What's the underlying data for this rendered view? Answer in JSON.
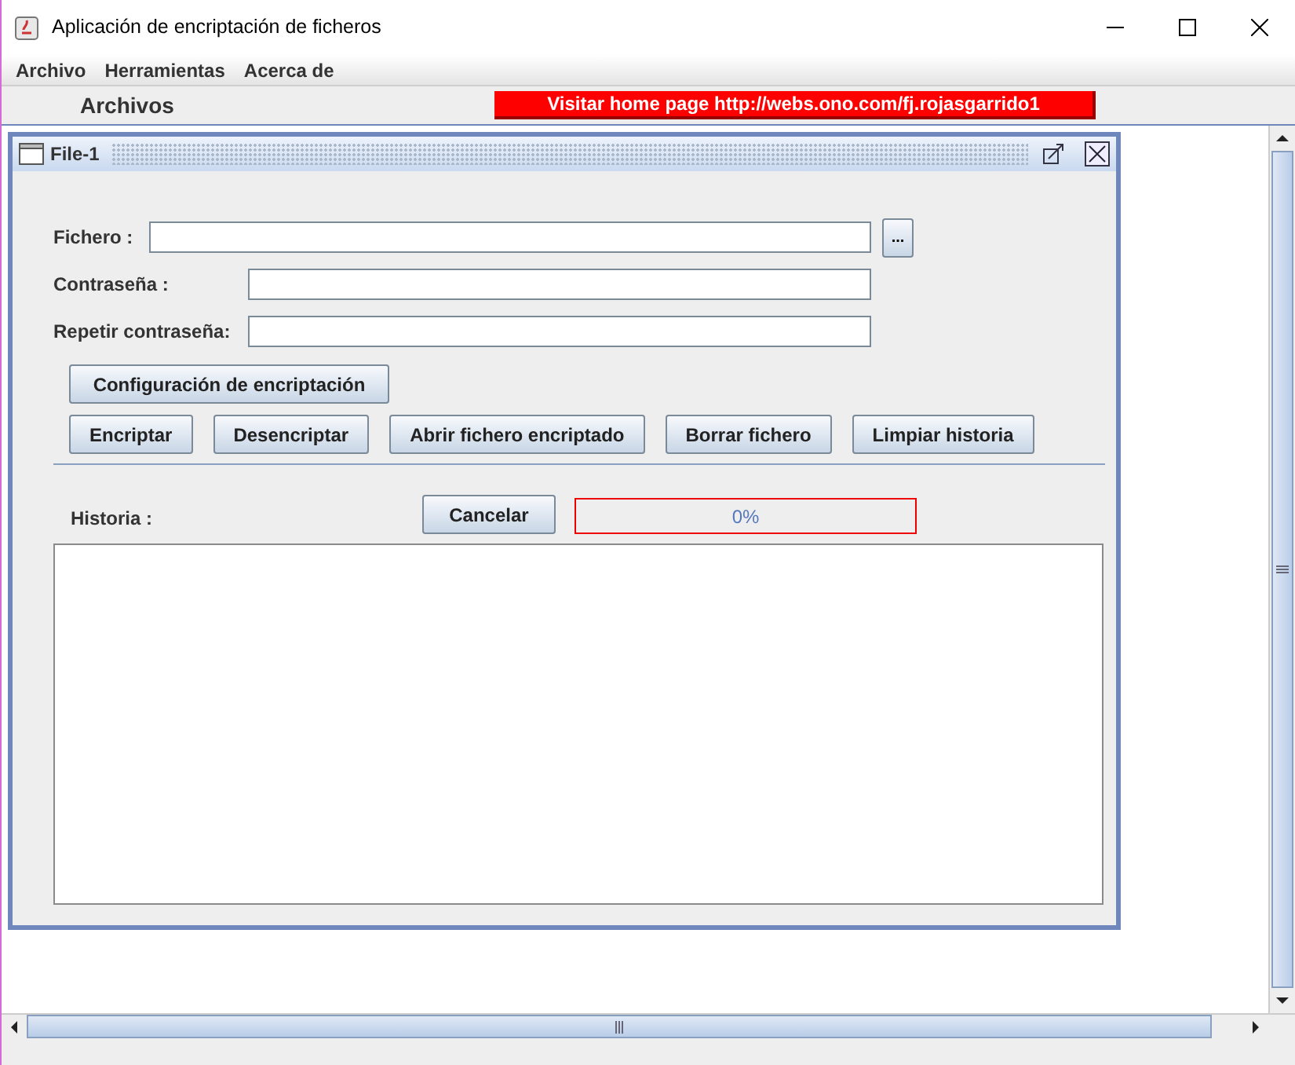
{
  "window": {
    "title": "Aplicación de encriptación de ficheros"
  },
  "menu": [
    "Archivo",
    "Herramientas",
    "Acerca de"
  ],
  "toolbar": {
    "heading": "Archivos",
    "link": "Visitar home page http://webs.ono.com/fj.rojasgarrido1"
  },
  "internal_frame": {
    "title": "File-1",
    "fields": [
      {
        "label": "Fichero :",
        "browse": "..."
      },
      {
        "label": "Contraseña :"
      },
      {
        "label": "Repetir contraseña:"
      }
    ],
    "config_button": "Configuración de encriptación",
    "actions": [
      "Encriptar",
      "Desencriptar",
      "Abrir fichero encriptado",
      "Borrar fichero",
      "Limpiar historia"
    ],
    "history_label": "Historia :",
    "cancel_button": "Cancelar",
    "progress": {
      "level": 0,
      "reading": "0%"
    }
  }
}
